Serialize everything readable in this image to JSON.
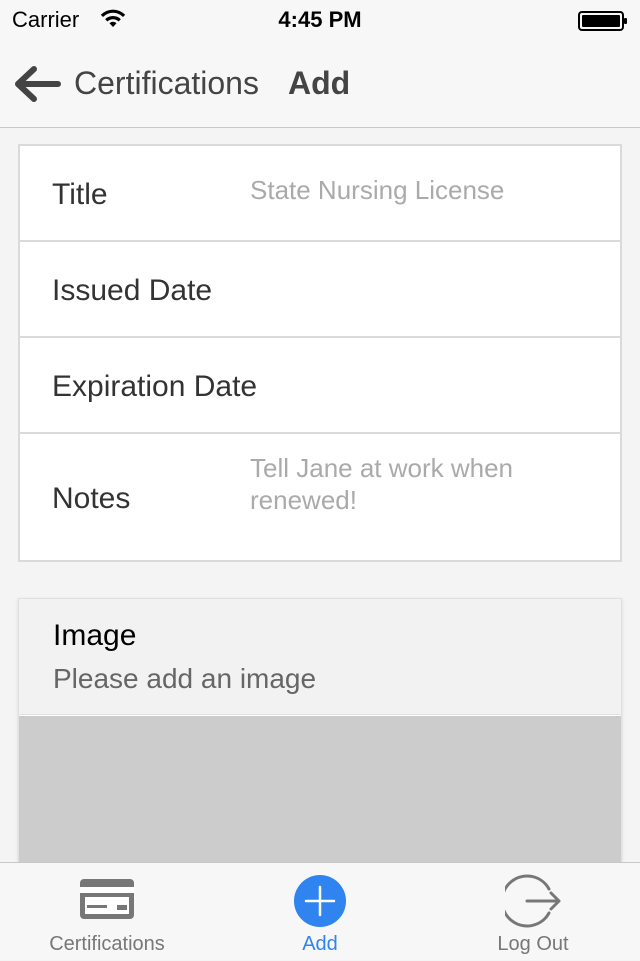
{
  "status_bar": {
    "carrier": "Carrier",
    "time": "4:45 PM"
  },
  "nav": {
    "back_title": "Certifications",
    "title": "Add"
  },
  "form": {
    "rows": [
      {
        "label": "Title",
        "value": "State Nursing License"
      },
      {
        "label": "Issued Date",
        "value": ""
      },
      {
        "label": "Expiration Date",
        "value": ""
      },
      {
        "label": "Notes",
        "value": "Tell Jane at work when renewed!"
      }
    ]
  },
  "image_section": {
    "title": "Image",
    "subtitle": "Please add an image"
  },
  "tabs": [
    {
      "label": "Certifications",
      "icon": "credit-card-icon",
      "active": false
    },
    {
      "label": "Add",
      "icon": "plus-circle-icon",
      "active": true
    },
    {
      "label": "Log Out",
      "icon": "logout-icon",
      "active": false
    }
  ],
  "colors": {
    "accent": "#2f84f0",
    "placeholder_gray": "#cccccc",
    "tab_inactive": "#777777"
  }
}
